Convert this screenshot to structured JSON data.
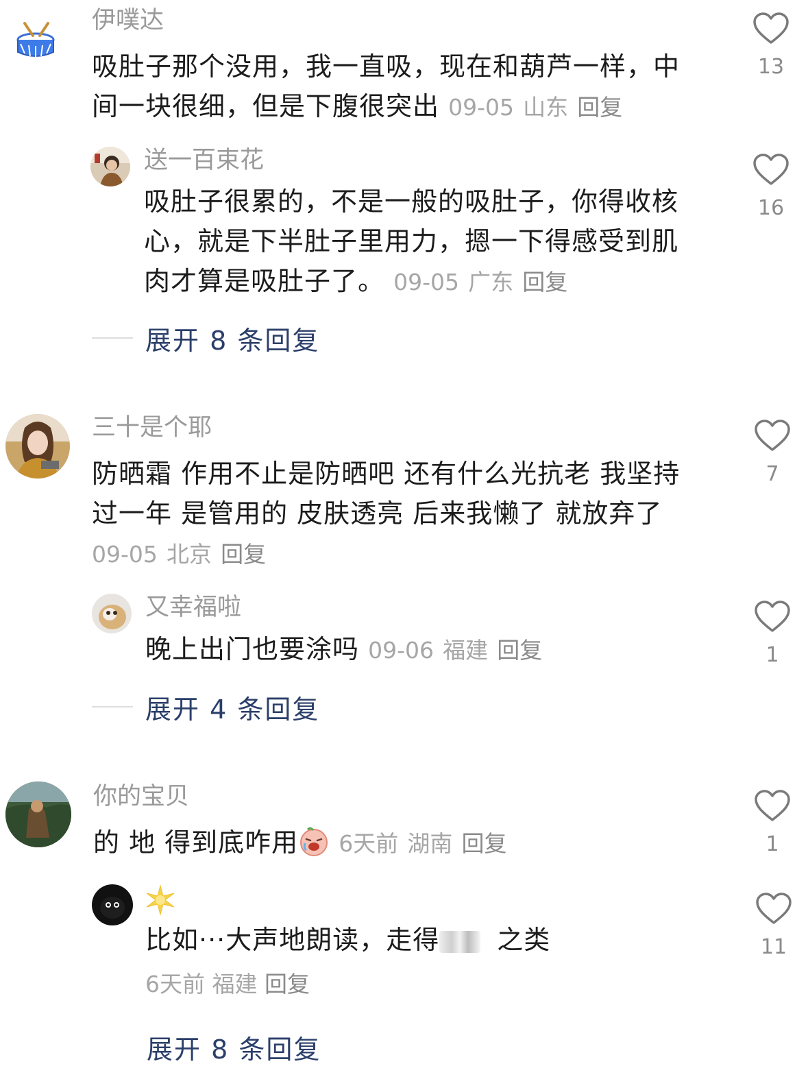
{
  "comments": [
    {
      "user": "伊噗达",
      "text": "吸肚子那个没用，我一直吸，现在和葫芦一样，中间一块很细，但是下腹很突出",
      "date": "09-05",
      "location": "山东",
      "reply_label": "回复",
      "likes": "13",
      "replies": [
        {
          "user": "送一百束花",
          "text": "吸肚子很累的，不是一般的吸肚子，你得收核心，就是下半肚子里用力，摁一下得感受到肌肉才算是吸肚子了。",
          "date": "09-05",
          "location": "广东",
          "reply_label": "回复",
          "likes": "16"
        }
      ],
      "expand_label": "展开 8 条回复"
    },
    {
      "user": "三十是个耶",
      "text": "防晒霜 作用不止是防晒吧 还有什么光抗老 我坚持过一年 是管用的 皮肤透亮 后来我懒了 就放弃了",
      "date": "09-05",
      "location": "北京",
      "reply_label": "回复",
      "likes": "7",
      "replies": [
        {
          "user": "又幸福啦",
          "text": "晚上出门也要涂吗",
          "date": "09-06",
          "location": "福建",
          "reply_label": "回复",
          "likes": "1"
        }
      ],
      "expand_label": "展开 4 条回复"
    },
    {
      "user": "你的宝贝",
      "text": "的 地 得到底咋用",
      "date": "6天前",
      "location": "湖南",
      "reply_label": "回复",
      "likes": "1",
      "replies": [
        {
          "user": "",
          "text_before": "比如···大声地朗读，走得",
          "text_after": "之类",
          "date": "6天前",
          "location": "福建",
          "reply_label": "回复",
          "likes": "11"
        }
      ],
      "expand_label": "展开 8 条回复"
    }
  ],
  "icons": {
    "like": "heart-outline-icon",
    "emoji": "crying-face-emoji-icon",
    "sparkle": "sparkle-icon"
  },
  "colors": {
    "text": "#1c1c1c",
    "meta": "#a6a6a6",
    "expand": "#2b3f6a",
    "heart": "#7a7a7a"
  }
}
